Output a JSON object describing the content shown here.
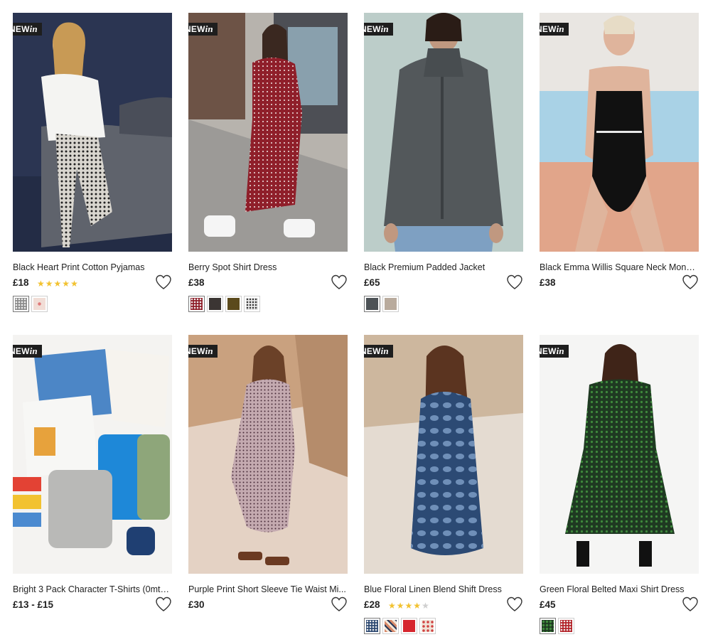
{
  "badge": {
    "new": "NEW",
    "in": "in"
  },
  "products": [
    {
      "title": "Black Heart Print Cotton Pyjamas",
      "price": "£18",
      "rating": 5,
      "swatches": [
        {
          "color": "#8c8c8c",
          "pattern": "dots",
          "selected": true
        },
        {
          "color": "#f1ddd6",
          "pattern": "dot",
          "selected": false
        }
      ]
    },
    {
      "title": "Berry Spot Shirt Dress",
      "price": "£38",
      "rating": 0,
      "swatches": [
        {
          "color": "#8f1f2a",
          "pattern": "dots",
          "selected": true
        },
        {
          "color": "#3b3533",
          "pattern": "plain",
          "selected": false
        },
        {
          "color": "#5b4a1c",
          "pattern": "plain",
          "selected": false
        },
        {
          "color": "#e9e9e9",
          "pattern": "dots-dark",
          "selected": false
        }
      ]
    },
    {
      "title": "Black Premium Padded Jacket",
      "price": "£65",
      "rating": 0,
      "swatches": [
        {
          "color": "#4d5256",
          "pattern": "plain",
          "selected": true
        },
        {
          "color": "#b9ab9d",
          "pattern": "plain",
          "selected": false
        }
      ]
    },
    {
      "title": "Black Emma Willis Square Neck Mono ...",
      "price": "£38",
      "rating": 0,
      "swatches": []
    },
    {
      "title": "Bright 3 Pack Character T-Shirts (0mth...",
      "price": "£13 - £15",
      "rating": 0,
      "swatches": []
    },
    {
      "title": "Purple Print Short Sleeve Tie Waist Mi...",
      "price": "£30",
      "rating": 0,
      "swatches": []
    },
    {
      "title": "Blue Floral Linen Blend Shift Dress",
      "price": "£28",
      "rating": 4,
      "swatches": [
        {
          "color": "#2e4a72",
          "pattern": "dots",
          "selected": true
        },
        {
          "color": "#d98a6a",
          "pattern": "stripes",
          "selected": false
        },
        {
          "color": "#d6262e",
          "pattern": "plain",
          "selected": false
        },
        {
          "color": "#f0e2d6",
          "pattern": "dots-red",
          "selected": false
        }
      ]
    },
    {
      "title": "Green Floral Belted Maxi Shirt Dress",
      "price": "£45",
      "rating": 0,
      "swatches": [
        {
          "color": "#1f3a22",
          "pattern": "dots-green",
          "selected": true
        },
        {
          "color": "#b3242a",
          "pattern": "dots",
          "selected": false
        }
      ]
    }
  ],
  "colors": {
    "star": "#f2c230",
    "badge_bg": "#1e1e1e",
    "heart_stroke": "#333333"
  },
  "icons": {
    "wishlist": "heart-icon",
    "rating": "star-icon"
  }
}
